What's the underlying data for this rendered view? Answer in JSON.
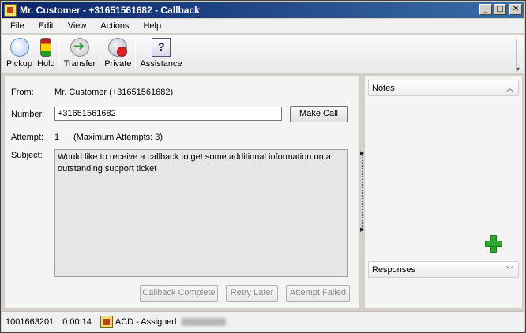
{
  "window": {
    "title": "Mr. Customer - +31651561682 - Callback",
    "minimize": "_",
    "maximize": "□",
    "close": "✕"
  },
  "menu": [
    "File",
    "Edit",
    "View",
    "Actions",
    "Help"
  ],
  "toolbar": {
    "pickup": "Pickup",
    "hold": "Hold",
    "transfer": "Transfer",
    "private": "Private",
    "assistance": "Assistance"
  },
  "form": {
    "from_label": "From:",
    "from_value": "Mr. Customer (+31651561682)",
    "number_label": "Number:",
    "number_value": "+31651561682",
    "make_call": "Make Call",
    "attempt_label": "Attempt:",
    "attempt_value": "1",
    "attempt_max": "(Maximum Attempts: 3)",
    "subject_label": "Subject:",
    "subject_value": "Would like to receive a callback to get some additional information on a outstanding support ticket"
  },
  "actions": {
    "callback_complete": "Callback Complete",
    "retry_later": "Retry Later",
    "attempt_failed": "Attempt Failed"
  },
  "right_panel": {
    "notes": "Notes",
    "responses": "Responses"
  },
  "statusbar": {
    "id": "1001663201",
    "timer": "0:00:14",
    "assignment": "ACD - Assigned:"
  }
}
